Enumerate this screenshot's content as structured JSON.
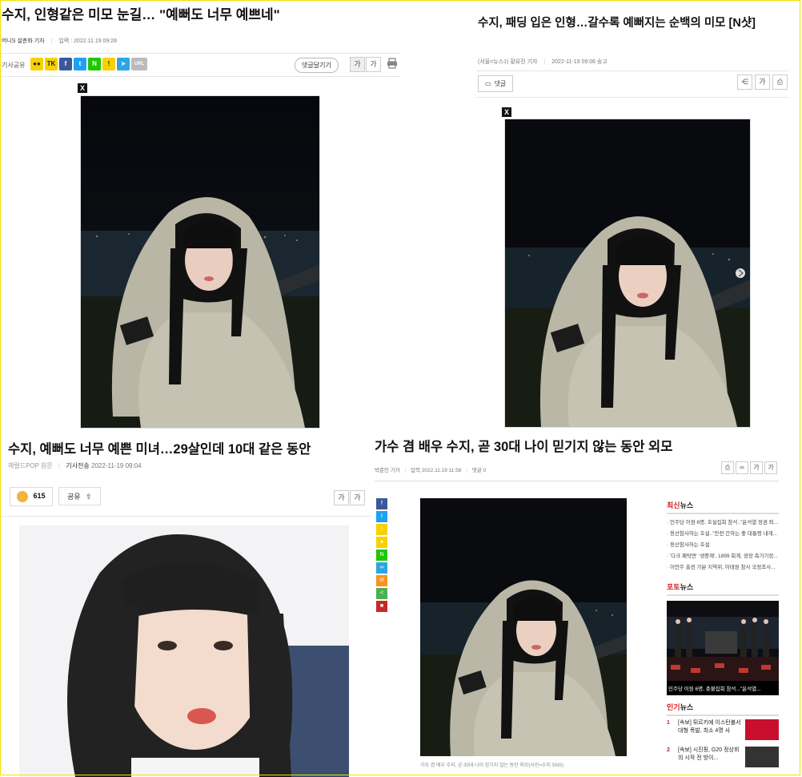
{
  "panel1": {
    "title": "수지, 인형같은 미모 눈길… \"예뻐도 너무 예쁘네\"",
    "meta_author": "머니S 설춘화 기자",
    "meta_date": "입력 : 2022.11.19 09:28",
    "share_label": "기사공유",
    "share_icons": [
      {
        "label": "●●",
        "color": "#f7d100"
      },
      {
        "label": "TK",
        "color": "#f7d100"
      },
      {
        "label": "f",
        "color": "#3b5998"
      },
      {
        "label": "t",
        "color": "#1da1f2"
      },
      {
        "label": "N",
        "color": "#1ec800"
      },
      {
        "label": "!",
        "color": "#f7d100"
      },
      {
        "label": "➤",
        "color": "#2ca5e0"
      },
      {
        "label": "URL",
        "color": "#bbb"
      }
    ],
    "comment_button": "댓글달기기",
    "font_big": "가",
    "font_small": "가",
    "close": "X"
  },
  "panel2": {
    "title": "수지, 패딩 입은 인형…갈수록 예뻐지는 순백의 미모 [N샷]",
    "meta_author": "(서울=뉴스1) 황유진 기자",
    "meta_date": "2022-11-19 09:06 송고",
    "comment_label": "댓글",
    "font_label": "가",
    "close": "X"
  },
  "panel3": {
    "title": "수지, 예뻐도 너무 예쁜 미녀…29살인데 10대 같은 동안",
    "source": "헤럴드POP 원문",
    "meta_label": "기사전송",
    "meta_date": "2022-11-19 09:04",
    "like_count": "615",
    "share_button": "공유",
    "font_small": "가",
    "font_big": "가"
  },
  "panel4": {
    "title": "가수 겸 배우 수지, 곧 30대 나이 믿기지 않는 동안 외모",
    "meta_author": "박준민 기자",
    "meta_date": "입력 2022.11.19 11:58",
    "meta_comment": "댓글 0",
    "font_big": "가",
    "font_small": "가",
    "caption": "가수 겸 배우 수지, 곧 30대 나이 믿기지 않는 동안 외모(사진=수지 SNS)",
    "side_icons": [
      {
        "label": "f",
        "color": "#3b5998"
      },
      {
        "label": "t",
        "color": "#1da1f2"
      },
      {
        "label": "!",
        "color": "#f7d100"
      },
      {
        "label": "●",
        "color": "#f7d100"
      },
      {
        "label": "N",
        "color": "#1ec800"
      },
      {
        "label": "∞",
        "color": "#2ca5e0"
      },
      {
        "label": "✉",
        "color": "#f7931e"
      },
      {
        "label": "<",
        "color": "#4caf50"
      },
      {
        "label": "■",
        "color": "#c62828"
      }
    ],
    "latest_news_red": "최신",
    "latest_news_black": "뉴스",
    "latest_items": [
      "민주당 이원 6명, 호설집회 참석..\"윤석열 정권 퇴...",
      "용산참사하는 호설..\"안전 간하는 좋 대통령 내게...",
      "용산참사하는 호설",
      "'다크 패탁면' '생중재', 1899 회계, 광장 측가기장...",
      "이만주 출전 가분 지역위, 이태원 참사 국정조사..."
    ],
    "photo_news_red": "포토",
    "photo_news_black": "뉴스",
    "photo_caption": "민주당 이원 6명, 촛불집회 참석...\"윤석열...",
    "popular_news_red": "인기",
    "popular_news_black": "뉴스",
    "popular_items": [
      {
        "num": "1",
        "text": "[속보] 튀르키예 이스탄불서 대형 폭발, 최소 4명 사"
      },
      {
        "num": "2",
        "text": "[속보] 시진핑, G20 정상회의 시작 전 방이..."
      }
    ]
  }
}
